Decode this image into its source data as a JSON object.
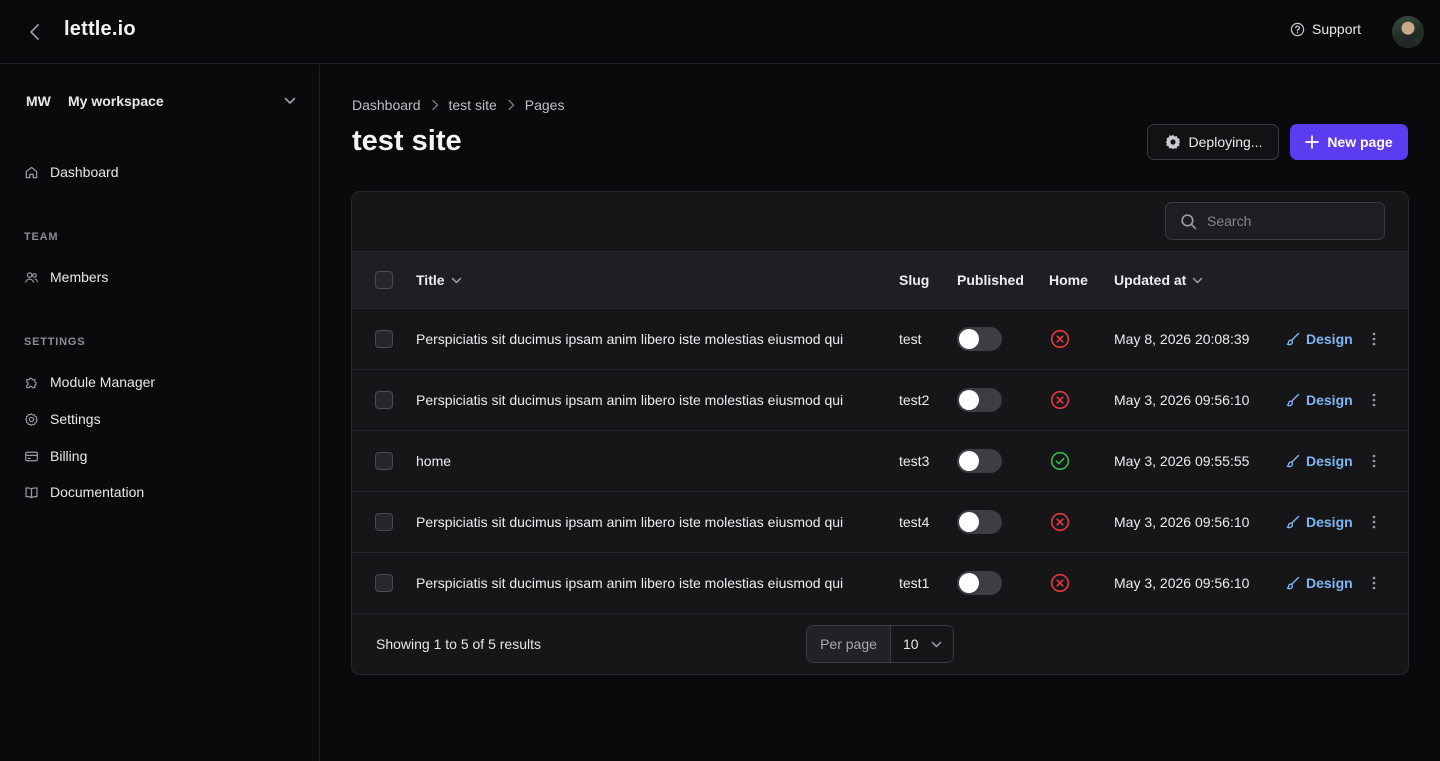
{
  "app": {
    "brand": "lettle.io",
    "support_label": "Support"
  },
  "sidebar": {
    "workspace": {
      "abbr": "MW",
      "name": "My workspace"
    },
    "primary": [
      {
        "label": "Dashboard",
        "icon": "home-icon"
      }
    ],
    "team_label": "TEAM",
    "team": [
      {
        "label": "Members",
        "icon": "users-icon"
      }
    ],
    "settings_label": "SETTINGS",
    "settings": [
      {
        "label": "Module Manager",
        "icon": "puzzle-icon"
      },
      {
        "label": "Settings",
        "icon": "gear-icon"
      },
      {
        "label": "Billing",
        "icon": "credit-card-icon"
      },
      {
        "label": "Documentation",
        "icon": "book-icon"
      }
    ]
  },
  "breadcrumb": [
    "Dashboard",
    "test site",
    "Pages"
  ],
  "page": {
    "title": "test site",
    "deploy_label": "Deploying...",
    "new_label": "New page",
    "search_placeholder": "Search"
  },
  "table": {
    "columns": {
      "title": "Title",
      "slug": "Slug",
      "published": "Published",
      "home": "Home",
      "updated": "Updated at"
    },
    "action_label": "Design",
    "rows": [
      {
        "title": "Perspiciatis sit ducimus ipsam anim libero iste molestias eiusmod qui",
        "slug": "test",
        "published": false,
        "home": false,
        "updated": "May 8, 2026 20:08:39"
      },
      {
        "title": "Perspiciatis sit ducimus ipsam anim libero iste molestias eiusmod qui",
        "slug": "test2",
        "published": false,
        "home": false,
        "updated": "May 3, 2026 09:56:10"
      },
      {
        "title": "home",
        "slug": "test3",
        "published": false,
        "home": true,
        "updated": "May 3, 2026 09:55:55"
      },
      {
        "title": "Perspiciatis sit ducimus ipsam anim libero iste molestias eiusmod qui",
        "slug": "test4",
        "published": false,
        "home": false,
        "updated": "May 3, 2026 09:56:10"
      },
      {
        "title": "Perspiciatis sit ducimus ipsam anim libero iste molestias eiusmod qui",
        "slug": "test1",
        "published": false,
        "home": false,
        "updated": "May 3, 2026 09:56:10"
      }
    ]
  },
  "footer": {
    "showing": "Showing 1 to 5 of 5 results",
    "per_page_label": "Per page",
    "per_page_value": "10"
  },
  "colors": {
    "accent": "#5b3cf0",
    "link": "#7eb6f2",
    "danger": "#e5383b",
    "success": "#2fb84f"
  }
}
